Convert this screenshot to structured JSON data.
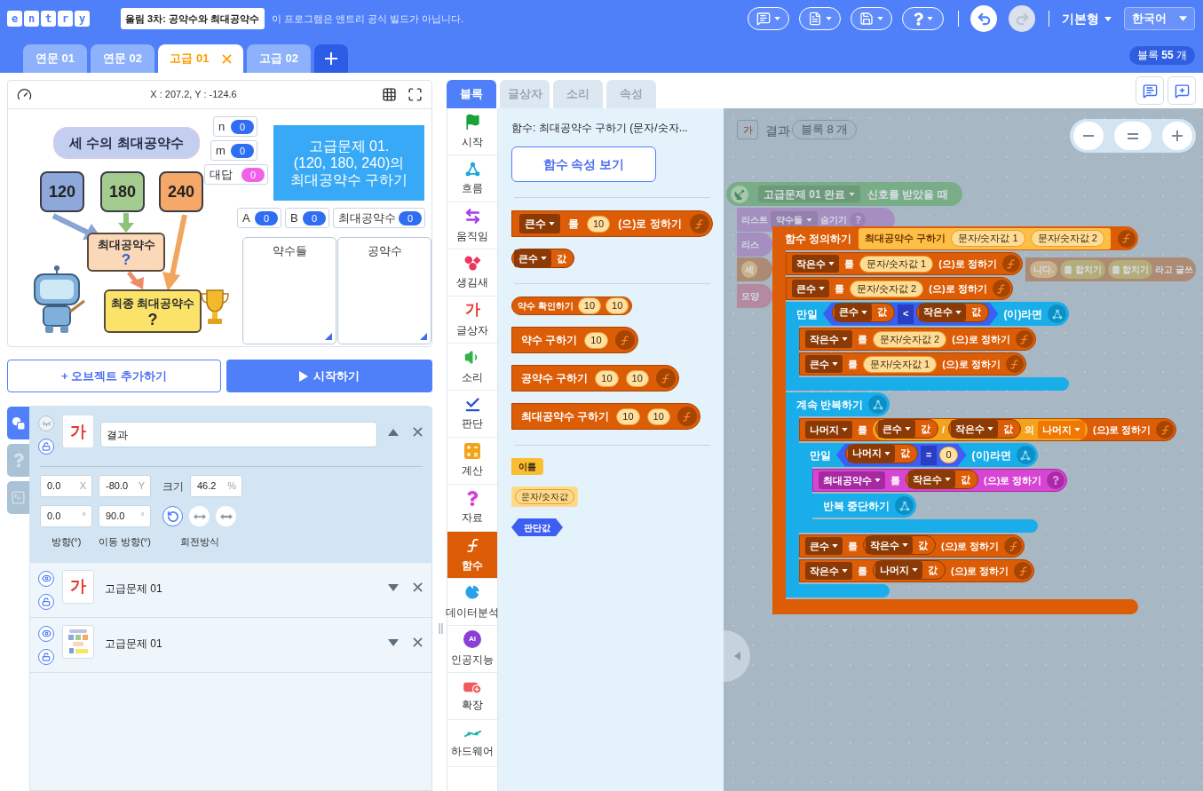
{
  "header": {
    "logo": [
      "e",
      "n",
      "t",
      "r",
      "y"
    ],
    "project_title": "올림 3차: 공약수와 최대공약수",
    "notice": "이 프로그램은 엔트리 공식 빌드가 아닙니다.",
    "undo": {
      "disabled": false
    },
    "redo": {
      "disabled": true
    },
    "mode": "기본형",
    "language": "한국어"
  },
  "scene_tabs": [
    {
      "label": "연문 01",
      "selected": false
    },
    {
      "label": "연문 02",
      "selected": false
    },
    {
      "label": "고급 01",
      "selected": true
    },
    {
      "label": "고급 02",
      "selected": false
    }
  ],
  "block_count": "블록 **55** 개",
  "stage": {
    "coordinates": "X : 207.2, Y : -124.6",
    "illustration": {
      "title": "세 수의 최대공약수",
      "numbers": [
        {
          "text": "120",
          "color": "#8fa8da"
        },
        {
          "text": "180",
          "color": "#a3cc8e"
        },
        {
          "text": "240",
          "color": "#f6a869"
        }
      ],
      "step": {
        "label": "최대공약수",
        "mark": "?"
      },
      "result": {
        "label": "최종 최대공약수",
        "mark": "?"
      }
    },
    "variables": [
      {
        "name": "n",
        "value": "0",
        "color": "#2f6df2"
      },
      {
        "name": "m",
        "value": "0",
        "color": "#2f6df2"
      },
      {
        "name": "대답",
        "value": "0",
        "color": "#f061ea"
      },
      {
        "name": "A",
        "value": "0",
        "color": "#2f6df2"
      },
      {
        "name": "B",
        "value": "0",
        "color": "#2f6df2"
      },
      {
        "name": "최대공약수",
        "value": "0",
        "color": "#2f6df2"
      }
    ],
    "text_box": "고급문제 01.\n(120, 180, 240)의\n최대공약수 구하기",
    "lists": [
      {
        "title": "약수들"
      },
      {
        "title": "공약수"
      }
    ]
  },
  "buttons": {
    "add_object": "+ 오브젝트 추가하기",
    "start": "시작하기"
  },
  "object_panel": {
    "side_tabs": [
      {
        "kind": "objects",
        "selected": true
      },
      {
        "kind": "help",
        "selected": false
      },
      {
        "kind": "console",
        "selected": false
      }
    ],
    "objects": [
      {
        "name": "결과",
        "thumbnail": {
          "kind": "text",
          "text": "가"
        },
        "visible": false,
        "expanded": true,
        "properties": {
          "x": {
            "value": "0.0",
            "unit": "X"
          },
          "y": {
            "value": "-80.0",
            "unit": "Y"
          },
          "size": {
            "label": "크기",
            "value": "46.2",
            "unit": "%"
          },
          "direction": {
            "value": "0.0",
            "unit": "°",
            "caption": "방향(°)"
          },
          "move_direction": {
            "value": "90.0",
            "unit": "°",
            "caption": "이동 방향(°)"
          },
          "rotation": {
            "caption": "회전방식",
            "modes": [
              {
                "kind": "free",
                "selected": true
              },
              {
                "kind": "horizontal",
                "selected": false
              },
              {
                "kind": "none",
                "selected": false
              }
            ]
          }
        }
      },
      {
        "name": "고급문제 01",
        "thumbnail": {
          "kind": "text",
          "text": "가"
        },
        "visible": true,
        "expanded": false
      },
      {
        "name": "고급문제 01",
        "thumbnail": {
          "kind": "image"
        },
        "visible": true,
        "expanded": false
      }
    ]
  },
  "block_menu": {
    "tabs": [
      {
        "label": "블록",
        "selected": true
      },
      {
        "label": "글상자",
        "selected": false
      },
      {
        "label": "소리",
        "selected": false
      },
      {
        "label": "속성",
        "selected": false
      }
    ],
    "categories": [
      {
        "kind": "start",
        "label": "시작",
        "selected": false
      },
      {
        "kind": "flow",
        "label": "흐름",
        "selected": false
      },
      {
        "kind": "moving",
        "label": "움직임",
        "selected": false
      },
      {
        "kind": "looks",
        "label": "생김새",
        "selected": false
      },
      {
        "kind": "text",
        "label": "글상자",
        "glyph": "가",
        "selected": false
      },
      {
        "kind": "sound",
        "label": "소리",
        "selected": false
      },
      {
        "kind": "judgement",
        "label": "판단",
        "selected": false
      },
      {
        "kind": "calc",
        "label": "계산",
        "selected": false
      },
      {
        "kind": "variable",
        "label": "자료",
        "selected": false
      },
      {
        "kind": "func",
        "label": "함수",
        "selected": true
      },
      {
        "kind": "analysis",
        "label": "데이터분석",
        "selected": false
      },
      {
        "kind": "ai",
        "label": "인공지능",
        "glyph": "AI",
        "selected": false
      },
      {
        "kind": "expansion",
        "label": "확장",
        "selected": false
      },
      {
        "kind": "hardware",
        "label": "하드웨어",
        "selected": false
      }
    ]
  },
  "palette": {
    "title": "함수: 최대공약수 구하기 (문자/숫자...",
    "properties_button": "함수 속성 보기",
    "groups": [
      [
        {
          "kind": "set_local",
          "variable": "큰수",
          "particle": "를",
          "value": {
            "kind": "number",
            "text": "10"
          },
          "suffix": "(으)로 정하기"
        },
        {
          "kind": "get_local",
          "variable": "큰수",
          "label": "값"
        }
      ],
      [
        {
          "kind": "reporter_call",
          "label": "약수 확인하기",
          "args": [
            "10",
            "10"
          ]
        },
        {
          "kind": "statement_call",
          "label": "약수 구하기",
          "args": [
            "10"
          ]
        },
        {
          "kind": "statement_call",
          "label": "공약수 구하기",
          "args": [
            "10",
            "10"
          ]
        },
        {
          "kind": "statement_call",
          "label": "최대공약수 구하기",
          "args": [
            "10",
            "10"
          ]
        }
      ],
      [
        {
          "kind": "name",
          "label": "이름"
        },
        {
          "kind": "string_param",
          "label": "문자/숫자값"
        },
        {
          "kind": "boolean_param",
          "label": "판단값"
        }
      ]
    ]
  },
  "canvas": {
    "object": {
      "glyph": "가",
      "name": "결과"
    },
    "block_count": "블록 8 개",
    "background_script": [
      {
        "kind": "signal",
        "parts": [
          {
            "kind": "dropdown",
            "text": "고급문제 01 완료"
          },
          {
            "kind": "label",
            "text": "신호를 받았을 때"
          }
        ]
      },
      {
        "kind": "list",
        "parts": [
          {
            "kind": "label",
            "text": "리스트"
          },
          {
            "kind": "dropdown",
            "text": "약수들"
          },
          {
            "kind": "label",
            "text": "숨기기"
          }
        ]
      },
      {
        "kind": "list",
        "parts": [
          {
            "kind": "label",
            "text": "리스"
          }
        ]
      },
      {
        "kind": "text",
        "parts": [
          {
            "kind": "text_input",
            "text": "세"
          }
        ]
      },
      {
        "kind": "text",
        "parts": [
          {
            "kind": "text_input",
            "text": "니다."
          },
          {
            "kind": "join",
            "text": "를 합치기"
          },
          {
            "kind": "join",
            "text": "를 합치기"
          },
          {
            "kind": "label",
            "text": "라고 글쓰"
          }
        ]
      },
      {
        "kind": "looks",
        "parts": [
          {
            "kind": "label",
            "text": "모양"
          }
        ]
      }
    ],
    "function_definition": {
      "label": "함수 정의하기",
      "name": "최대공약수 구하기",
      "params": [
        "문자/숫자값 1",
        "문자/숫자값 2"
      ],
      "body": [
        {
          "kind": "set_local",
          "variable": "작은수",
          "particle": "를",
          "value": {
            "kind": "param",
            "text": "문자/숫자값 1"
          },
          "suffix": "(으)로 정하기"
        },
        {
          "kind": "set_local",
          "variable": "큰수",
          "particle": "를",
          "value": {
            "kind": "param",
            "text": "문자/숫자값 2"
          },
          "suffix": "(으)로 정하기"
        },
        {
          "kind": "if",
          "label": "만일",
          "condition": {
            "left": {
              "kind": "get_local",
              "variable": "큰수",
              "label": "값"
            },
            "op": "<",
            "right": {
              "kind": "get_local",
              "variable": "작은수",
              "label": "값"
            }
          },
          "suffix": "(이)라면",
          "body": [
            {
              "kind": "set_local",
              "variable": "작은수",
              "particle": "를",
              "value": {
                "kind": "param",
                "text": "문자/숫자값 2"
              },
              "suffix": "(으)로 정하기"
            },
            {
              "kind": "set_local",
              "variable": "큰수",
              "particle": "를",
              "value": {
                "kind": "param",
                "text": "문자/숫자값 1"
              },
              "suffix": "(으)로 정하기"
            }
          ]
        },
        {
          "kind": "loop",
          "label": "계속 반복하기",
          "body": [
            {
              "kind": "set_local",
              "variable": "나머지",
              "particle": "를",
              "value": {
                "kind": "calc",
                "left": {
                  "kind": "get_local",
                  "variable": "큰수",
                  "label": "값"
                },
                "op": "/",
                "right": {
                  "kind": "get_local",
                  "variable": "작은수",
                  "label": "값"
                },
                "particle": "의",
                "mode": "나머지"
              },
              "suffix": "(으)로 정하기"
            },
            {
              "kind": "if",
              "label": "만일",
              "condition": {
                "left": {
                  "kind": "get_local",
                  "variable": "나머지",
                  "label": "값"
                },
                "op": "=",
                "right": {
                  "kind": "number",
                  "text": "0"
                }
              },
              "suffix": "(이)라면",
              "body": [
                {
                  "kind": "set_global",
                  "variable": "최대공약수",
                  "particle": "를",
                  "value": {
                    "kind": "get_local",
                    "variable": "작은수",
                    "label": "값"
                  },
                  "suffix": "(으)로 정하기"
                },
                {
                  "kind": "break",
                  "label": "반복 중단하기"
                }
              ]
            },
            {
              "kind": "set_local",
              "variable": "큰수",
              "particle": "를",
              "value": {
                "kind": "get_local",
                "variable": "작은수",
                "label": "값"
              },
              "suffix": "(으)로 정하기"
            },
            {
              "kind": "set_local",
              "variable": "작은수",
              "particle": "를",
              "value": {
                "kind": "get_local",
                "variable": "나머지",
                "label": "값"
              },
              "suffix": "(으)로 정하기"
            }
          ]
        }
      ]
    }
  }
}
